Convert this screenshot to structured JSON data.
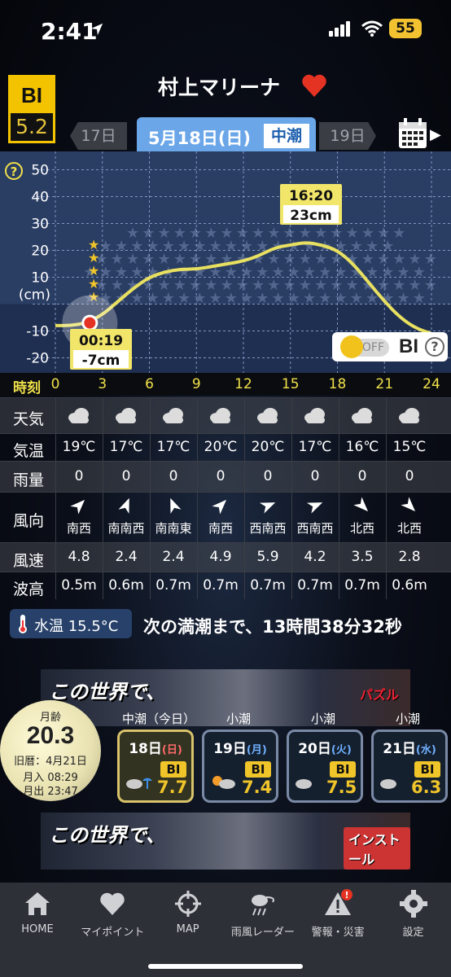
{
  "status": {
    "time": "2:41",
    "battery": "55"
  },
  "header": {
    "bi_label": "BI",
    "bi_value": "5.2",
    "place": "村上マリーナ",
    "prev_day": "17日",
    "date": "5月18日(日)",
    "tide_type": "中潮",
    "next_day": "19日"
  },
  "chart_data": {
    "type": "line",
    "ylabel": "(cm)",
    "ylim": [
      -25,
      55
    ],
    "yticks": [
      50,
      40,
      30,
      20,
      10,
      -10,
      -20
    ],
    "x_label": "時刻",
    "xticks": [
      0,
      3,
      6,
      9,
      12,
      15,
      18,
      21,
      24
    ],
    "x": [
      0,
      1,
      2,
      3,
      4,
      5,
      6,
      7,
      8,
      9,
      10,
      11,
      12,
      13,
      14,
      15,
      16,
      17,
      18,
      19,
      20,
      21,
      22,
      23,
      24
    ],
    "values": [
      -8,
      -8,
      -7,
      -4,
      1,
      6,
      10,
      12,
      13,
      13,
      14,
      15,
      16,
      18,
      21,
      22,
      23,
      22,
      20,
      15,
      8,
      1,
      -5,
      -9,
      -11
    ],
    "annotations": [
      {
        "time": "00:19",
        "value": "-7cm",
        "type": "low"
      },
      {
        "time": "16:20",
        "value": "23cm",
        "type": "high"
      }
    ],
    "stars_left": 5
  },
  "bi_toggle": {
    "state": "OFF",
    "label": "BI",
    "help": "?"
  },
  "weather": {
    "labels": {
      "weather": "天気",
      "temp": "気温",
      "rain": "雨量",
      "wind_dir": "風向",
      "wind_speed": "風速",
      "wave": "波高"
    },
    "columns": [
      {
        "icon": "cloud-icon",
        "temp": "19℃",
        "rain": "0",
        "dir": "南西",
        "speed": "4.8",
        "wave": "0.5m"
      },
      {
        "icon": "cloud-icon",
        "temp": "17℃",
        "rain": "0",
        "dir": "南南西",
        "speed": "2.4",
        "wave": "0.6m"
      },
      {
        "icon": "cloud-icon",
        "temp": "17℃",
        "rain": "0",
        "dir": "南南東",
        "speed": "2.4",
        "wave": "0.7m"
      },
      {
        "icon": "cloud-icon",
        "temp": "20℃",
        "rain": "0",
        "dir": "南西",
        "speed": "4.9",
        "wave": "0.7m"
      },
      {
        "icon": "cloud-icon",
        "temp": "20℃",
        "rain": "0",
        "dir": "西南西",
        "speed": "5.9",
        "wave": "0.7m"
      },
      {
        "icon": "cloud-icon",
        "temp": "17℃",
        "rain": "0",
        "dir": "西南西",
        "speed": "4.2",
        "wave": "0.7m"
      },
      {
        "icon": "cloud-icon",
        "temp": "16℃",
        "rain": "0",
        "dir": "北西",
        "speed": "3.5",
        "wave": "0.7m"
      },
      {
        "icon": "cloud-icon",
        "temp": "15℃",
        "rain": "0",
        "dir": "北西",
        "speed": "2.8",
        "wave": "0.6m"
      }
    ]
  },
  "water_temp": "水温 15.5°C",
  "next_high_tide": "次の満潮まで、13時間38分32秒",
  "ads": [
    {
      "title": "この世界で、",
      "brand": "パズル"
    },
    {
      "title": "この世界で、",
      "brand": "インストール"
    }
  ],
  "moon": {
    "age_label": "月齢",
    "age": "20.3",
    "old_cal": "旧暦：4月21日",
    "moonrise": "月入 08:29",
    "moonset": "月出 23:47"
  },
  "days": [
    {
      "tide": "中潮（今日）",
      "day": "18日",
      "weekday": "(日)",
      "bi": "BI",
      "value": "7.7",
      "selected": true
    },
    {
      "tide": "小潮",
      "day": "19日",
      "weekday": "(月)",
      "bi": "BI",
      "value": "7.4",
      "selected": false
    },
    {
      "tide": "小潮",
      "day": "20日",
      "weekday": "(火)",
      "bi": "BI",
      "value": "7.5",
      "selected": false
    },
    {
      "tide": "小潮",
      "day": "21日",
      "weekday": "(水)",
      "bi": "BI",
      "value": "6.3",
      "selected": false
    }
  ],
  "nav": [
    {
      "label": "HOME",
      "icon": "home-icon"
    },
    {
      "label": "マイポイント",
      "icon": "heart-icon"
    },
    {
      "label": "MAP",
      "icon": "crosshair-icon"
    },
    {
      "label": "雨風レーダー",
      "icon": "rain-wind-icon"
    },
    {
      "label": "警報・災害",
      "icon": "warning-icon"
    },
    {
      "label": "設定",
      "icon": "gear-icon"
    }
  ],
  "colors": {
    "accent": "#f3c300",
    "date_blue": "#6aa6e8",
    "curve": "#e8e060",
    "heart": "#e53323"
  }
}
